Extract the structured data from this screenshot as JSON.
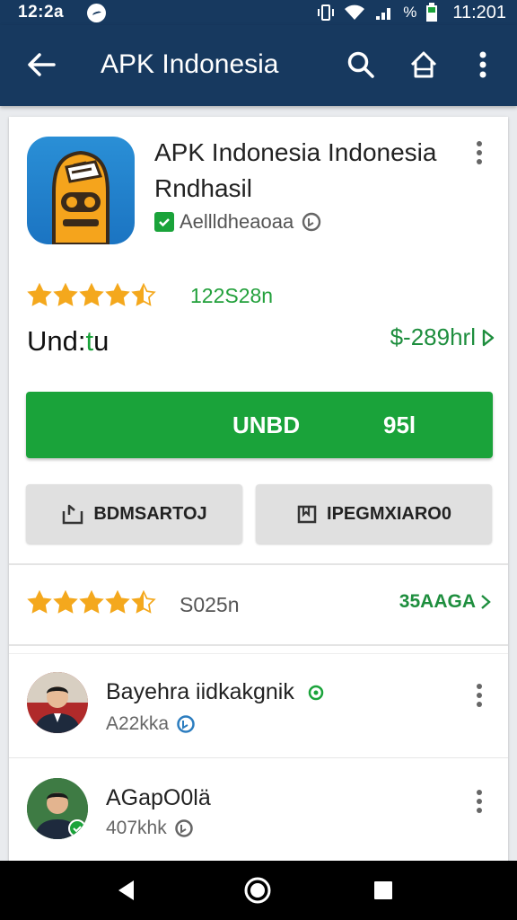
{
  "status_bar": {
    "time_left": "12:2a",
    "time_right": "11:201",
    "battery_label": "%"
  },
  "app_bar": {
    "title": "APK Indonesia"
  },
  "app": {
    "title_line1": "APK Indonesia Indonesia",
    "title_line2": "Rndhasil",
    "developer": "Aellldheaoaa",
    "rating_stars": 4.5,
    "rating_count": "122S28n",
    "installs_prefix": "Und:",
    "installs_accent": "t",
    "installs_suffix": "u",
    "price_label": "$-289hrl"
  },
  "buttons": {
    "install_left": "UNBD",
    "install_right": "95l",
    "secondary_left": "BDMSARTOJ",
    "secondary_right": "IPEGMXIARO0"
  },
  "rating_summary": {
    "stars": 4.5,
    "count": "S025n",
    "link": "35AAGA"
  },
  "reviews": [
    {
      "name": "Bayehra iidkakgnik",
      "meta": "A22kka"
    },
    {
      "name": "AGapO0lä",
      "meta": "407khk"
    }
  ],
  "colors": {
    "app_bar": "#17395f",
    "accent_green": "#1aa33a",
    "link_green": "#1e8e3e",
    "star": "#f4a81d"
  }
}
